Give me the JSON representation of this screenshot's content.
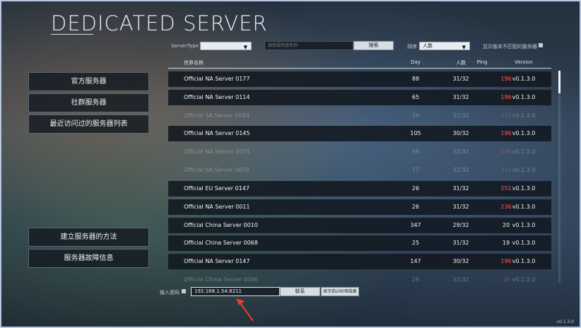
{
  "header": {
    "title": "DEDICATED SERVER"
  },
  "filters": {
    "server_type_label": "ServerType",
    "server_type_value": "",
    "search_placeholder": "搜索服务器名称",
    "search_button": "搜索",
    "sort_label": "排序",
    "sort_value": "人数",
    "show_mismatch_label": "显示版本不匹配的服务器"
  },
  "sidebar": {
    "items": [
      {
        "label": "官方服务器"
      },
      {
        "label": "社群服务器"
      },
      {
        "label": "最近访问过的服务器列表"
      },
      {
        "label": "建立服务器的方法"
      },
      {
        "label": "服务器故障信息"
      }
    ]
  },
  "table": {
    "columns": {
      "name": "世界名称",
      "day": "Day",
      "players": "人数",
      "ping": "Ping",
      "version": "Version"
    },
    "rows": [
      {
        "name": "Official NA Server 0177",
        "day": "88",
        "players": "31/32",
        "ping": "196",
        "version": "v0.1.3.0",
        "ping_color": "#ff5a5a",
        "dim": false
      },
      {
        "name": "Official NA Server 0114",
        "day": "65",
        "players": "31/32",
        "ping": "196",
        "version": "v0.1.3.0",
        "ping_color": "#ff5a5a",
        "dim": false
      },
      {
        "name": "Official SA Server 0083",
        "day": "39",
        "players": "32/32",
        "ping": "315",
        "version": "v0.1.3.0",
        "ping_color": "#ff7a7a",
        "dim": true
      },
      {
        "name": "Official NA Server 0145",
        "day": "105",
        "players": "30/32",
        "ping": "196",
        "version": "v0.1.3.0",
        "ping_color": "#ff5a5a",
        "dim": false
      },
      {
        "name": "Official NA Server 0074",
        "day": "58",
        "players": "32/32",
        "ping": "196",
        "version": "v0.1.3.0",
        "ping_color": "#ff7a7a",
        "dim": true
      },
      {
        "name": "Official SA Server 0079",
        "day": "77",
        "players": "32/32",
        "ping": "315",
        "version": "v0.1.3.0",
        "ping_color": "#ff7a7a",
        "dim": true
      },
      {
        "name": "Official EU Server 0147",
        "day": "26",
        "players": "31/32",
        "ping": "251",
        "version": "v0.1.3.0",
        "ping_color": "#ff5a5a",
        "dim": false
      },
      {
        "name": "Official NA Server 0011",
        "day": "26",
        "players": "31/32",
        "ping": "236",
        "version": "v0.1.3.0",
        "ping_color": "#ff5a5a",
        "dim": false
      },
      {
        "name": "Official China Server 0010",
        "day": "347",
        "players": "29/32",
        "ping": "20",
        "version": "v0.1.3.0",
        "ping_color": "#f3f5f7",
        "dim": false
      },
      {
        "name": "Official China Server 0068",
        "day": "25",
        "players": "31/32",
        "ping": "19",
        "version": "v0.1.3.0",
        "ping_color": "#f3f5f7",
        "dim": false
      },
      {
        "name": "Official NA Server 0147",
        "day": "147",
        "players": "30/32",
        "ping": "196",
        "version": "v0.1.3.0",
        "ping_color": "#ff5a5a",
        "dim": false
      },
      {
        "name": "Official China Server 0046",
        "day": "29",
        "players": "32/32",
        "ping": "19",
        "version": "v0.1.3.0",
        "ping_color": "#f3f5f7",
        "dim": true
      }
    ]
  },
  "bottom": {
    "password_label": "输入密码",
    "address_value": "192.168.1.54:8211",
    "connect_button": "联系",
    "show_top_button": "显示前200项结果"
  },
  "footer": {
    "version": "v0.1.3.0"
  },
  "colors": {
    "ping_red": "#ff5a5a",
    "arrow": "#e8402f",
    "accent_border": "#b9c8e2"
  }
}
